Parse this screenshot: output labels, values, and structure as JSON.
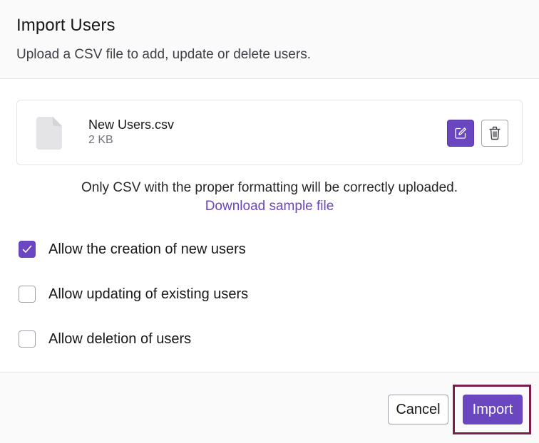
{
  "dialog": {
    "title": "Import Users",
    "subtitle": "Upload a CSV file to add, update or delete users."
  },
  "file": {
    "name": "New Users.csv",
    "size": "2 KB",
    "icon": "file-icon",
    "edit_icon": "edit-icon",
    "delete_icon": "trash-icon"
  },
  "notice": {
    "text": "Only CSV with the proper formatting will be correctly uploaded.",
    "link": "Download sample file"
  },
  "options": [
    {
      "label": "Allow the creation of new users",
      "checked": true
    },
    {
      "label": "Allow updating of existing users",
      "checked": false
    },
    {
      "label": "Allow deletion of users",
      "checked": false
    }
  ],
  "footer": {
    "cancel_label": "Cancel",
    "import_label": "Import"
  },
  "colors": {
    "accent": "#6b46c1",
    "highlight_frame": "#7a1f4a"
  }
}
